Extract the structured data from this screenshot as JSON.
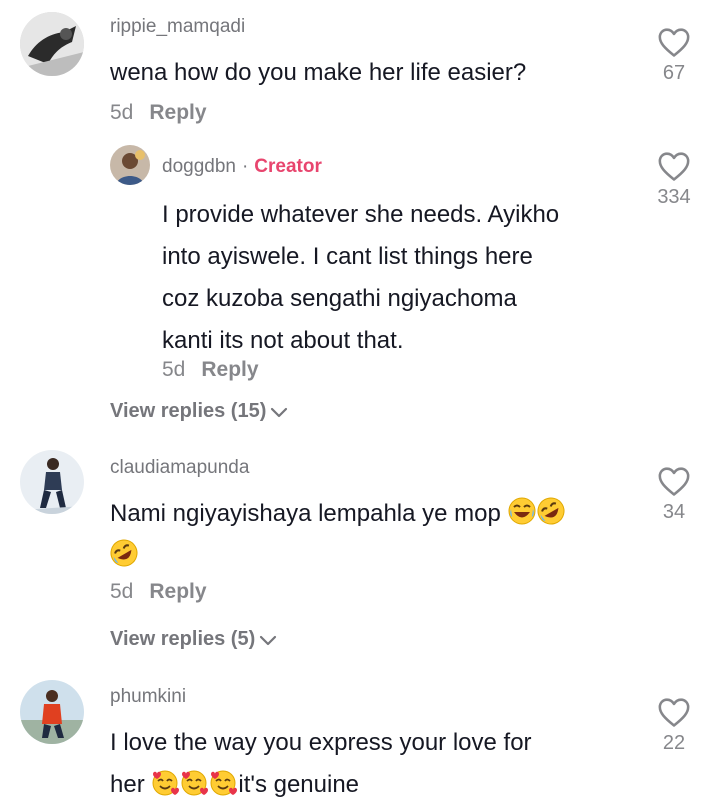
{
  "comments": [
    {
      "username": "rippie_mamqadi",
      "text": "wena how do you make her life easier?",
      "age": "5d",
      "reply_label": "Reply",
      "likes": "67",
      "reply": {
        "username": "doggdbn",
        "separator": "·",
        "badge": "Creator",
        "lines": [
          "I provide whatever she needs. Ayikho",
          "into ayiswele. I cant list things here",
          "coz kuzoba sengathi ngiyachoma",
          "kanti its not about that."
        ],
        "age": "5d",
        "reply_label": "Reply",
        "likes": "334"
      },
      "view_replies": "View replies (15)"
    },
    {
      "username": "claudiamapunda",
      "text": "Nami ngiyayishaya lempahla ye mop",
      "emojis": [
        "joy-emoji",
        "rofl-emoji",
        "rofl-emoji"
      ],
      "age": "5d",
      "reply_label": "Reply",
      "likes": "34",
      "view_replies": "View replies (5)"
    },
    {
      "username": "phumkini",
      "line1": "I love the way you express your love for",
      "line2_start": "her",
      "line2_end": "it's genuine",
      "emojis": [
        "smiling-hearts-emoji",
        "smiling-hearts-emoji",
        "smiling-hearts-emoji"
      ],
      "likes": "22"
    }
  ],
  "colors": {
    "text": "#161823",
    "secondary": "#86878b",
    "creator": "#e8456e"
  }
}
